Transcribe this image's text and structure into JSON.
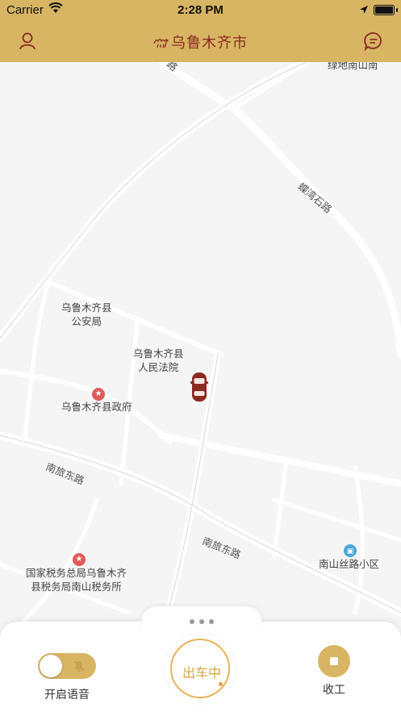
{
  "status_bar": {
    "carrier": "Carrier",
    "time": "2:28 PM"
  },
  "nav": {
    "title": "乌鲁木齐市",
    "left_icon": "user-icon",
    "right_icon": "message-icon"
  },
  "map": {
    "labels": {
      "lvdi": "绿地南山南",
      "road_nw": "路",
      "road_diag": "蝶湾石路",
      "gonganju_1": "乌鲁木齐县",
      "gonganju_2": "公安局",
      "fayuan_1": "乌鲁木齐县",
      "fayuan_2": "人民法院",
      "zhengfu": "乌鲁木齐县政府",
      "nanlv_1": "南旅东路",
      "nanlv_2": "南旅东路",
      "shuiwu_1": "国家税务总局乌鲁木齐",
      "shuiwu_2": "县税务局南山税务所",
      "sichou": "南山丝路小区"
    }
  },
  "bottom": {
    "voice_label": "开启语音",
    "main_label": "出车中",
    "stop_label": "收工"
  },
  "colors": {
    "accent": "#d7b563",
    "title": "#8a2a22",
    "car": "#8a2a22"
  }
}
